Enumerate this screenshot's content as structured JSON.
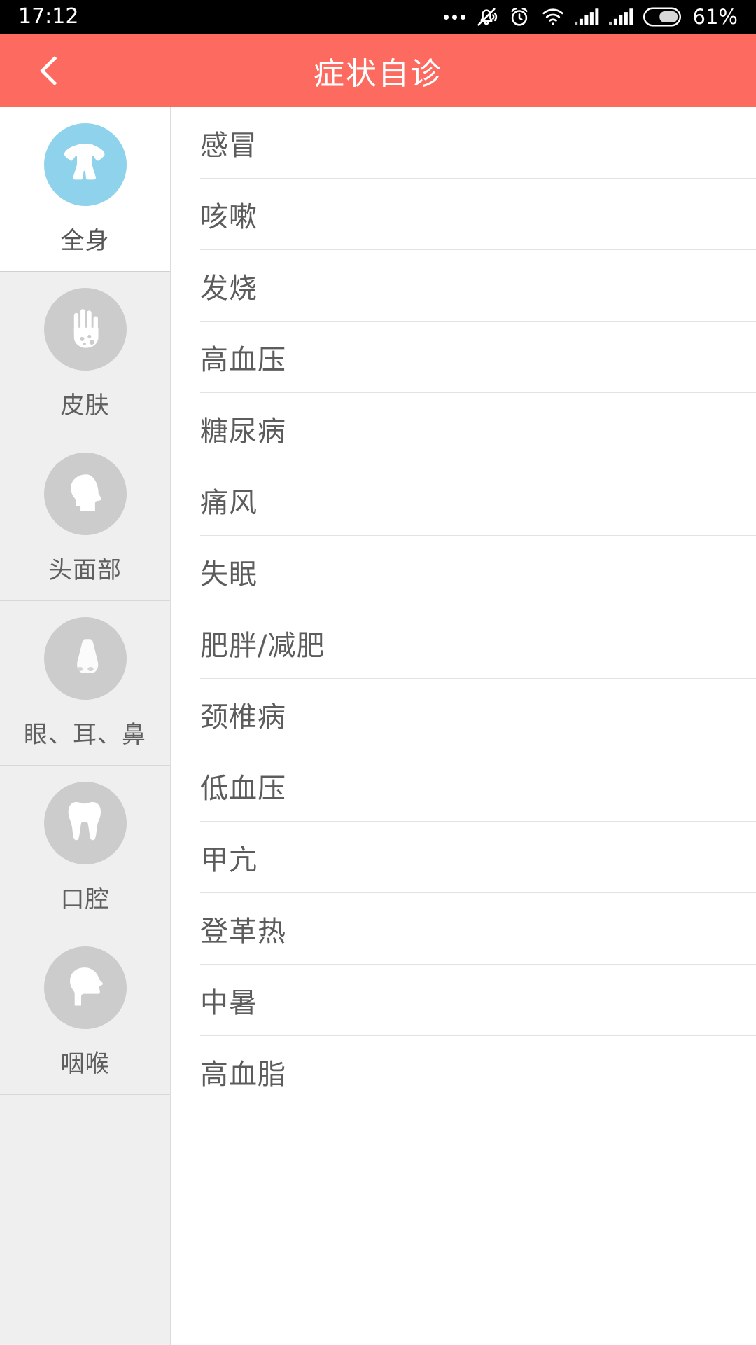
{
  "status_bar": {
    "time": "17:12",
    "battery_percent": "61%",
    "icons": [
      "more-dots-icon",
      "bell-muted-icon",
      "alarm-clock-icon",
      "wifi-icon",
      "signal-bars-icon",
      "signal-bars-icon",
      "battery-icon"
    ]
  },
  "header": {
    "title": "症状自诊",
    "back_icon": "chevron-left-icon",
    "background_color": "#fc6a60",
    "text_color": "#ffffff"
  },
  "sidebar": {
    "active_index": 0,
    "active_icon_color": "#8ed2ec",
    "inactive_icon_color": "#cccccc",
    "items": [
      {
        "label": "全身",
        "icon": "torso-body-icon",
        "selected": true
      },
      {
        "label": "皮肤",
        "icon": "hand-rash-icon",
        "selected": false
      },
      {
        "label": "头面部",
        "icon": "head-profile-icon",
        "selected": false
      },
      {
        "label": "眼、耳、鼻",
        "icon": "nose-icon",
        "selected": false
      },
      {
        "label": "口腔",
        "icon": "tooth-icon",
        "selected": false
      },
      {
        "label": "咽喉",
        "icon": "throat-head-icon",
        "selected": false
      }
    ]
  },
  "list": {
    "items": [
      {
        "label": "感冒"
      },
      {
        "label": "咳嗽"
      },
      {
        "label": "发烧"
      },
      {
        "label": "高血压"
      },
      {
        "label": "糖尿病"
      },
      {
        "label": "痛风"
      },
      {
        "label": "失眠"
      },
      {
        "label": "肥胖/减肥"
      },
      {
        "label": "颈椎病"
      },
      {
        "label": "低血压"
      },
      {
        "label": "甲亢"
      },
      {
        "label": "登革热"
      },
      {
        "label": "中暑"
      },
      {
        "label": "高血脂"
      }
    ]
  }
}
